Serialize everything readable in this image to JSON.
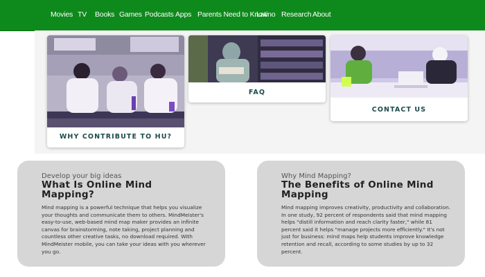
{
  "nav": {
    "items": [
      "Movies",
      "TV",
      "Books",
      "Games",
      "Podcasts",
      "Apps",
      "Parents Need to Know",
      "Latino",
      "Research",
      "About"
    ]
  },
  "cards": [
    {
      "title": "WHY CONTRIBUTE TO HU?",
      "image": "students-in-laboratory-photo"
    },
    {
      "title": "FAQ",
      "image": "student-reading-in-library-photo"
    },
    {
      "title": "CONTACT US",
      "image": "students-at-laptops-photo"
    }
  ],
  "sections": [
    {
      "kicker": "Develop your big ideas",
      "heading": "What Is Online Mind Mapping?",
      "body": "Mind mapping is a powerful technique that helps you visualize your thoughts and communicate them to others. MindMeister's easy-to-use, web-based mind map maker provides an infinite canvas for brainstorming, note taking, project planning and countless other creative tasks, no download required. With MindMeister mobile, you can take your ideas with you wherever you go."
    },
    {
      "kicker": "Why Mind Mapping?",
      "heading": "The Benefits of Online Mind Mapping",
      "body": "Mind mapping improves creativity, productivity and collaboration. In one study, 92 percent of respondents said that mind mapping helps \"distill information and reach clarity faster,\" while 81 percent said it helps \"manage projects more efficiently.\" It's not just for business: mind maps help students improve knowledge retention and recall, according to some studies by up to 32 percent."
    }
  ],
  "colors": {
    "nav_bg": "#0e8a1c",
    "card_title": "#1d4a4a",
    "box_bg": "#d6d6d6"
  }
}
